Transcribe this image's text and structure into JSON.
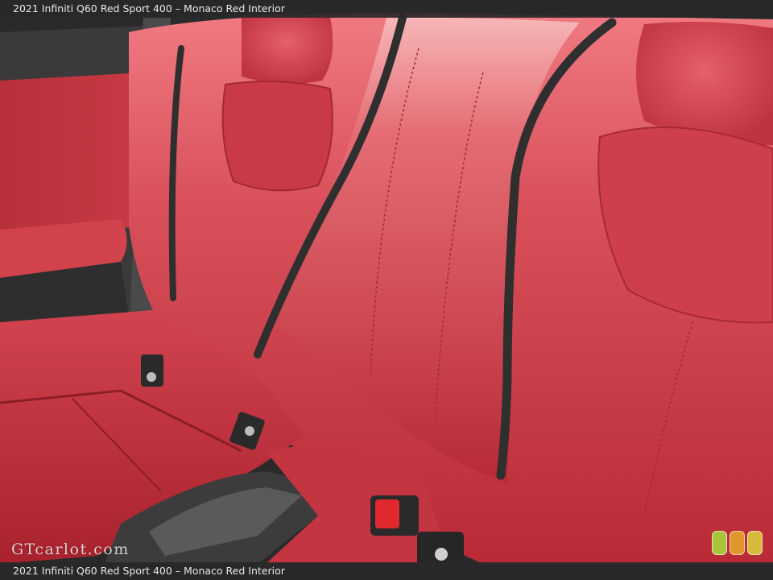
{
  "caption": {
    "top": "2021 Infiniti Q60 Red Sport 400 – Monaco Red Interior",
    "bottom": "2021 Infiniti Q60 Red Sport 400 – Monaco Red Interior"
  },
  "watermark": "GTcarlot.com",
  "colors": {
    "leather": "#c8353f",
    "leather_light": "#e86670",
    "piping": "#2f2f2f",
    "dot_green": "#a9c43a",
    "dot_orange": "#e0962c",
    "dot_yellow": "#d8b93a"
  }
}
